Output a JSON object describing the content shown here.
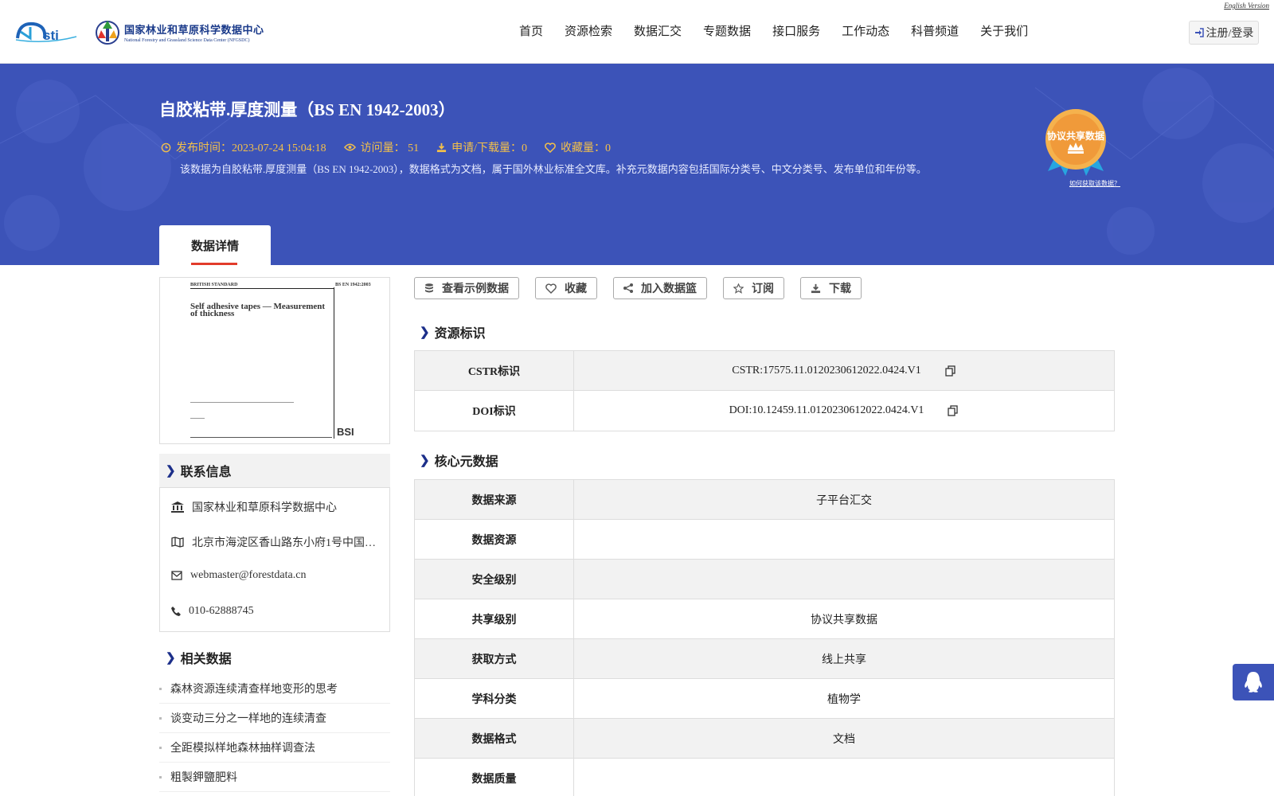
{
  "header": {
    "english_link": "English Version",
    "logo_center_cn": "国家林业和草原科学数据中心",
    "logo_center_en": "National Forestry and Grassland Science Data Center (NFGSDC)",
    "nav": [
      "首页",
      "资源检索",
      "数据汇交",
      "专题数据",
      "接口服务",
      "工作动态",
      "科普频道",
      "关于我们"
    ],
    "login_label": "注册/登录"
  },
  "banner": {
    "title": "自胶粘带.厚度测量（BS EN 1942-2003）",
    "publish": "发布时间：2023-07-24 15:04:18",
    "views": "访问量： 51",
    "downloads": "申请/下载量：0",
    "favorites": "收藏量：0",
    "description": "该数据为自胶粘带.厚度测量（BS EN 1942-2003），数据格式为文档，属于国外林业标准全文库。补充元数据内容包括国际分类号、中文分类号、发布单位和年份等。",
    "badge_text": "协议共享数据",
    "how_to": "如何获取该数据？",
    "tab_label": "数据详情"
  },
  "thumbnail": {
    "standard": "BRITISH STANDARD",
    "code": "BS EN 1942:2003",
    "heading": "Self adhesive tapes — Measurement of thickness",
    "brand": "BSI"
  },
  "contact": {
    "heading": "联系信息",
    "org": "国家林业和草原科学数据中心",
    "address": "北京市海淀区香山路东小府1号中国…",
    "email": "webmaster@forestdata.cn",
    "phone": "010-62888745"
  },
  "related": {
    "heading": "相关数据",
    "items": [
      "森林资源连续清查样地变形的思考",
      "谈变动三分之一样地的连续清查",
      "全距模拟样地森林抽样调查法",
      "粗製鉀鹽肥料"
    ]
  },
  "actions": {
    "sample": "查看示例数据",
    "favorite": "收藏",
    "basket": "加入数据篮",
    "subscribe": "订阅",
    "download": "下载"
  },
  "identity": {
    "heading": "资源标识",
    "rows": [
      {
        "key": "CSTR标识",
        "value": "CSTR:17575.11.0120230612022.0424.V1"
      },
      {
        "key": "DOI标识",
        "value": "DOI:10.12459.11.0120230612022.0424.V1"
      }
    ]
  },
  "core": {
    "heading": "核心元数据",
    "rows": [
      {
        "key": "数据来源",
        "value": "子平台汇交"
      },
      {
        "key": "数据资源",
        "value": ""
      },
      {
        "key": "安全级别",
        "value": ""
      },
      {
        "key": "共享级别",
        "value": "协议共享数据"
      },
      {
        "key": "获取方式",
        "value": "线上共享"
      },
      {
        "key": "学科分类",
        "value": "植物学"
      },
      {
        "key": "数据格式",
        "value": "文档"
      },
      {
        "key": "数据质量",
        "value": ""
      }
    ]
  },
  "colors": {
    "banner": "#3c53b8",
    "accent": "#f3c04a",
    "tab_underline": "#e23b2b",
    "chevron": "#1c2f8a"
  }
}
